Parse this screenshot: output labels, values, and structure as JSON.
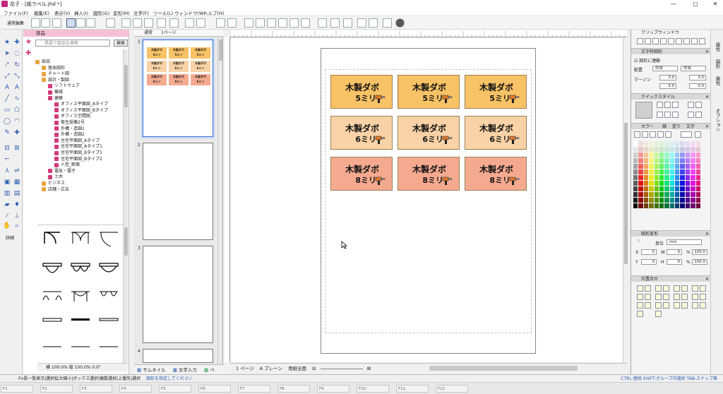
{
  "window": {
    "title": "花子 - [紙ラベル.jhd *]",
    "minimize": "—",
    "maximize": "▢",
    "close": "✕"
  },
  "menu": [
    "ファイル(F)",
    "編集(E)",
    "表示(V)",
    "挿入(I)",
    "図形(G)",
    "変形(M)",
    "文字(F)",
    "ツール(L)",
    "ウィンドウ(W)",
    "ヘルプ(H)"
  ],
  "toolbar": {
    "mode_label": "通常編集"
  },
  "parts_panel": {
    "title": "部品",
    "search_placeholder": "単語で部品を検索",
    "search_button": "検索",
    "tree": [
      {
        "label": "部品",
        "level": 0,
        "folder": true
      },
      {
        "label": "基本図形",
        "level": 1,
        "folder": false
      },
      {
        "label": "チャート図",
        "level": 1,
        "folder": false
      },
      {
        "label": "設計・製図",
        "level": 1,
        "folder": false
      },
      {
        "label": "ソフトウェア",
        "level": 2,
        "folder": false
      },
      {
        "label": "機械",
        "level": 2,
        "folder": false
      },
      {
        "label": "建築",
        "level": 2,
        "folder": false
      },
      {
        "label": "オフィス平面図_Aタイプ",
        "level": 3,
        "folder": false
      },
      {
        "label": "オフィス平面図_Bタイプ",
        "level": 3,
        "folder": false
      },
      {
        "label": "オフィス空間図",
        "level": 3,
        "folder": false
      },
      {
        "label": "衛生設備2号",
        "level": 3,
        "folder": false
      },
      {
        "label": "外構・造園1",
        "level": 3,
        "folder": false
      },
      {
        "label": "外構・造園2",
        "level": 3,
        "folder": false
      },
      {
        "label": "住宅平面図_Aタイプ",
        "level": 3,
        "folder": false
      },
      {
        "label": "住宅平面図_Aタイプ1",
        "level": 3,
        "folder": false
      },
      {
        "label": "住宅平面図_Bタイプ1",
        "level": 3,
        "folder": false
      },
      {
        "label": "住宅平面図_Bタイプ2",
        "level": 3,
        "folder": false
      },
      {
        "label": "人型_断面",
        "level": 3,
        "folder": false
      },
      {
        "label": "電気・電子",
        "level": 2,
        "folder": false
      },
      {
        "label": "土木",
        "level": 2,
        "folder": false
      },
      {
        "label": "ビジネス",
        "level": 1,
        "folder": false
      },
      {
        "label": "店舗・広告",
        "level": 1,
        "folder": false
      }
    ],
    "footer": "横 100.0% 縦 100.0% 0.0°"
  },
  "thumbnails": {
    "tab1": "通常",
    "tab2": "1ページ",
    "pages": [
      "1",
      "2",
      "3",
      "4"
    ],
    "bottom_tabs": [
      "サムネイル",
      "文字入力",
      "ペ"
    ]
  },
  "labels": [
    {
      "line1": "木製ダボ",
      "line2": "5ミリ",
      "color": "#f8c266"
    },
    {
      "line1": "木製ダボ",
      "line2": "5ミリ",
      "color": "#f8c266"
    },
    {
      "line1": "木製ダボ",
      "line2": "5ミリ",
      "color": "#f8c266"
    },
    {
      "line1": "木製ダボ",
      "line2": "6ミリ",
      "color": "#f9d3a7"
    },
    {
      "line1": "木製ダボ",
      "line2": "6ミリ",
      "color": "#f9d3a7"
    },
    {
      "line1": "木製ダボ",
      "line2": "6ミリ",
      "color": "#f9d3a7"
    },
    {
      "line1": "木製ダボ",
      "line2": "8ミリ",
      "color": "#f5aa90"
    },
    {
      "line1": "木製ダボ",
      "line2": "8ミリ",
      "color": "#f5aa90"
    },
    {
      "line1": "木製ダボ",
      "line2": "8ミリ",
      "color": "#f5aa90"
    }
  ],
  "pagebar": {
    "page": "1 ページ",
    "layer": "A ブレーン",
    "view": "用紙全面"
  },
  "right_panel": {
    "clip_title": "クリップウィンドウ",
    "text_frame_title": "文字枠図形",
    "follow_label": "図形に連動",
    "align_label": "配置",
    "align_h": "中央",
    "align_v": "中央",
    "margin_label": "マージン",
    "margin_values": [
      "3.0",
      "3.0",
      "3.0",
      "3.0"
    ],
    "quick_style_title": "クイックスタイル",
    "color_title": "カラー",
    "color_tabs": [
      "線",
      "塗り",
      "文字"
    ],
    "transform_title": "図形変形",
    "unit_label": "単位",
    "unit_value": "mm",
    "transform_fields": [
      {
        "k": "X",
        "v": "0"
      },
      {
        "k": "W",
        "v": "0"
      },
      {
        "k": "%",
        "v": "100.0"
      },
      {
        "k": "Y",
        "v": "0"
      },
      {
        "k": "H",
        "v": "0"
      },
      {
        "k": "%",
        "v": "100.0"
      }
    ],
    "align_panel_title": "位置合せ"
  },
  "side_tabs": [
    "属性",
    "図形",
    "属性",
    "オプション"
  ],
  "status": {
    "left": "Fn長一覧表示|選択拡大縮小|ボックス選択|複数選択|上優先|選択",
    "hint": "図形を指定してください",
    "right": "CTRL:連続 SHIFT:グループ内選択 TAB:スナップ無"
  },
  "fkeys": [
    "F1",
    "F2",
    "F3",
    "F4",
    "F5",
    "F6",
    "F7",
    "F8",
    "F9",
    "F10",
    "F11",
    "F12"
  ],
  "colors": {
    "accent": "#3b6fd1",
    "parts_header": "#f5c0d6"
  }
}
